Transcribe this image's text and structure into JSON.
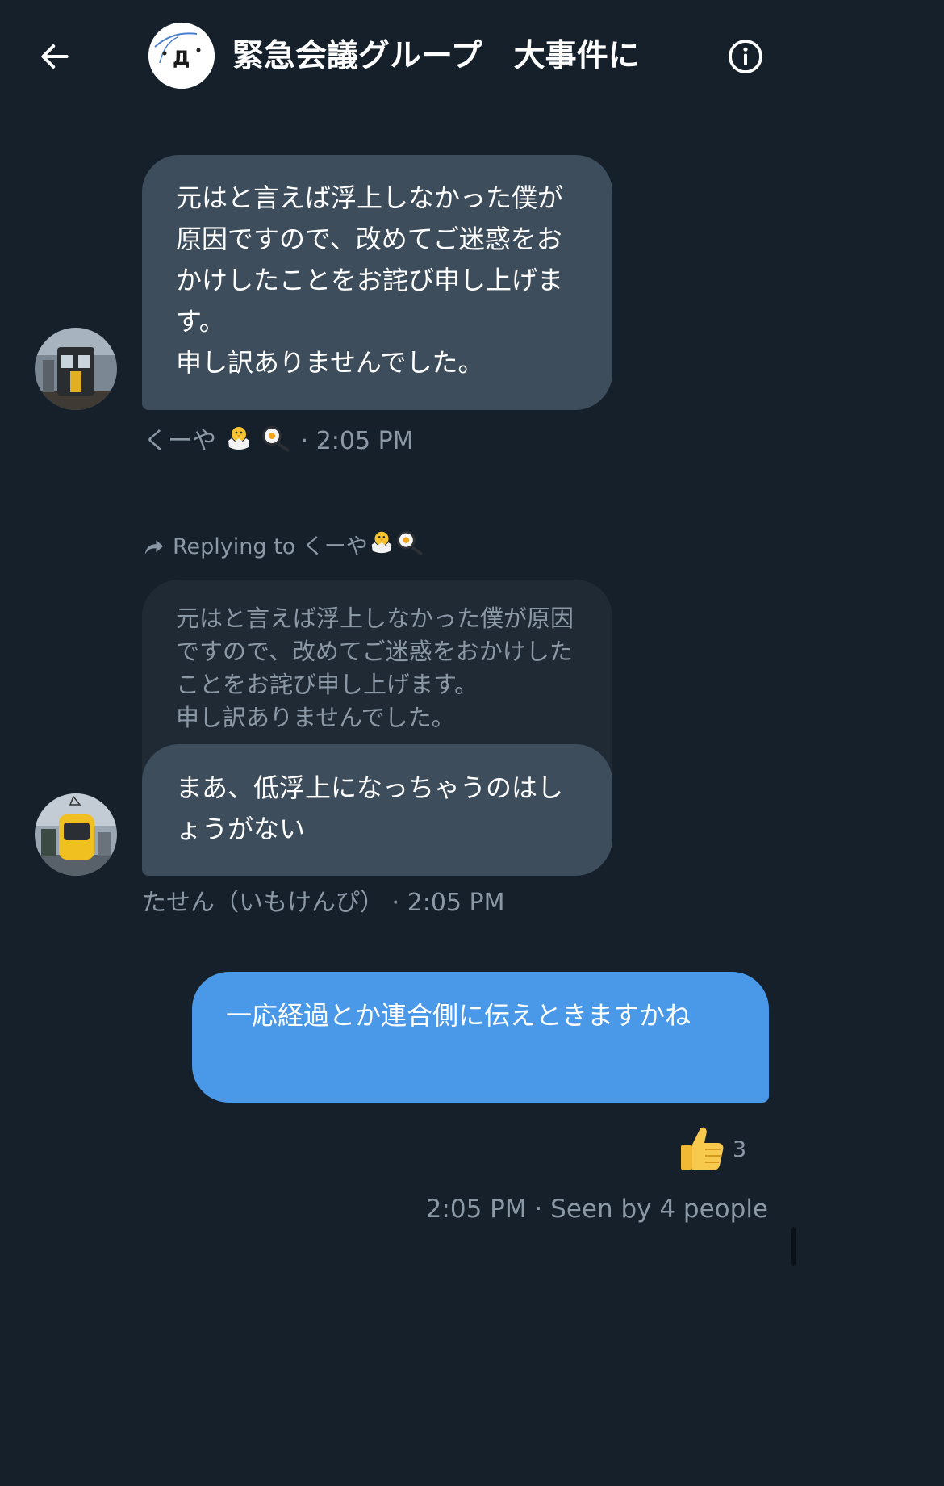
{
  "header": {
    "back_icon": "arrow-left-icon",
    "group_name": "緊急会議グループ　大事件に",
    "info_icon": "info-circle-icon"
  },
  "messages": [
    {
      "text": "元はと言えば浮上しなかった僕が原因ですので、改めてご迷惑をおかけしたことをお詫び申し上げます。\n申し訳ありませんでした。",
      "sender": "くーや",
      "time": "· 2:05 PM"
    },
    {
      "reply_label": "Replying to くーや",
      "quoted_text": "元はと言えば浮上しなかった僕が原因ですので、改めてご迷惑をおかけしたことをお詫び申し上げます。\n申し訳ありませんでした。",
      "text": "まあ、低浮上になっちゃうのはしょうがない",
      "sender": "たせん（いもけんぴ）",
      "time": "· 2:05 PM"
    },
    {
      "text": "一応経過とか連合側に伝えときますかね",
      "reaction": {
        "icon": "thumbs-up-icon",
        "count": "3"
      },
      "status": "2:05 PM · Seen by 4 people"
    }
  ],
  "colors": {
    "background": "#15202b",
    "incoming_bubble": "#3d4d5c",
    "outgoing_bubble": "#4a99e9",
    "muted_text": "#8b98a5"
  }
}
